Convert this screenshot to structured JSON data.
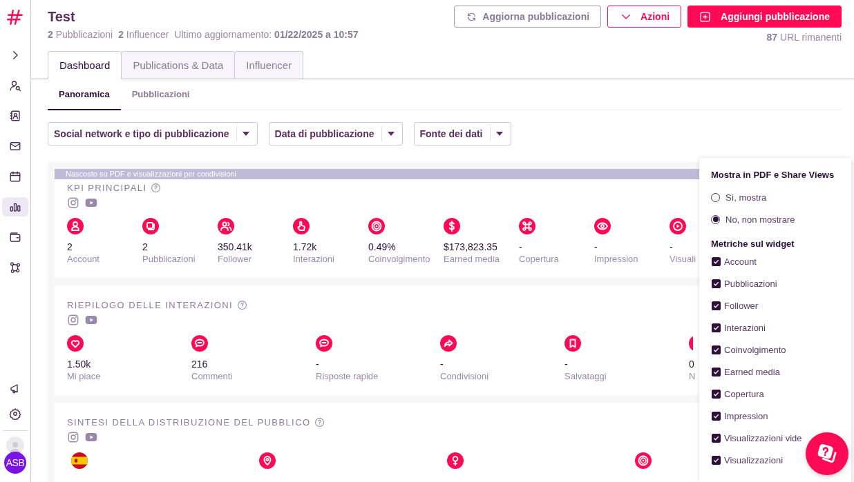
{
  "sidebar": {
    "items": [
      {
        "selected": false
      },
      {
        "selected": false
      },
      {
        "selected": false
      },
      {
        "selected": false
      },
      {
        "selected": true
      },
      {
        "selected": false
      },
      {
        "selected": false
      }
    ],
    "avatar": "ASB"
  },
  "header": {
    "title": "Test",
    "meta": [
      "**2** Pubblicazioni",
      "**2** Influencer",
      "Ultimo aggiornamento: **01/22/2025 a 10:57**"
    ],
    "buttons": [
      {
        "label": "Aggiorna pubblicazioni",
        "kind": "secondary"
      },
      {
        "label": "Azioni",
        "kind": "outline"
      },
      {
        "label": "Aggiungi pubblicazione",
        "kind": "primary"
      }
    ],
    "quota": "**87** URL rimanenti"
  },
  "tabs": [
    {
      "label": "Dashboard",
      "selected": true
    },
    {
      "label": "Publications & Data",
      "selected": false
    },
    {
      "label": "Influencer",
      "selected": false
    }
  ],
  "subtabs": [
    {
      "label": "Panoramica",
      "selected": true
    },
    {
      "label": "Pubblicazioni",
      "selected": false
    }
  ],
  "filters": [
    {
      "label": "Social network e tipo di pubblicazione"
    },
    {
      "label": "Data di pubblicazione"
    },
    {
      "label": "Fonte dei dati"
    }
  ],
  "widgets": [
    {
      "kind": "kpi",
      "banner": "Nascosto su PDF e visualizzazioni per condivisioni",
      "title": "KPI PRINCIPALI",
      "metrics": [
        {
          "value": "2",
          "label": "Account"
        },
        {
          "value": "2",
          "label": "Pubblicazioni"
        },
        {
          "value": "350.41k",
          "label": "Follower"
        },
        {
          "value": "1.72k",
          "label": "Interazioni"
        },
        {
          "value": "0.49%",
          "label": "Coinvolgimento"
        },
        {
          "value": "$173,823.35",
          "label": "Earned media"
        },
        {
          "value": "-",
          "label": "Copertura"
        },
        {
          "value": "-",
          "label": "Impression"
        },
        {
          "value": "-",
          "label": "Visuali"
        }
      ]
    },
    {
      "kind": "interactions",
      "title": "RIEPILOGO DELLE INTERAZIONI",
      "metrics": [
        {
          "value": "1.50k",
          "label": "Mi piace"
        },
        {
          "value": "216",
          "label": "Commenti"
        },
        {
          "value": "-",
          "label": "Risposte rapide"
        },
        {
          "value": "-",
          "label": "Condivisioni"
        },
        {
          "value": "-",
          "label": "Salvataggi"
        },
        {
          "value": "0",
          "label": "N"
        }
      ]
    },
    {
      "kind": "audience",
      "title": "SINTESI DELLA DISTRIBUZIONE DEL PUBBLICO"
    }
  ],
  "visibility_panel": {
    "title": "Mostra in PDF e Share Views",
    "options": [
      {
        "label": "Sì, mostra",
        "selected": false
      },
      {
        "label": "No, non mostrare",
        "selected": true
      }
    ],
    "metrics_title": "Metriche sul widget",
    "metrics": [
      {
        "label": "Account",
        "checked": true
      },
      {
        "label": "Pubblicazioni",
        "checked": true
      },
      {
        "label": "Follower",
        "checked": true
      },
      {
        "label": "Interazioni",
        "checked": true
      },
      {
        "label": "Coinvolgimento",
        "checked": true
      },
      {
        "label": "Earned media",
        "checked": true
      },
      {
        "label": "Copertura",
        "checked": true
      },
      {
        "label": "Impression",
        "checked": true
      },
      {
        "label": "Visualizzazioni vide",
        "checked": true
      },
      {
        "label": "Visualizzazioni",
        "checked": true
      }
    ]
  }
}
